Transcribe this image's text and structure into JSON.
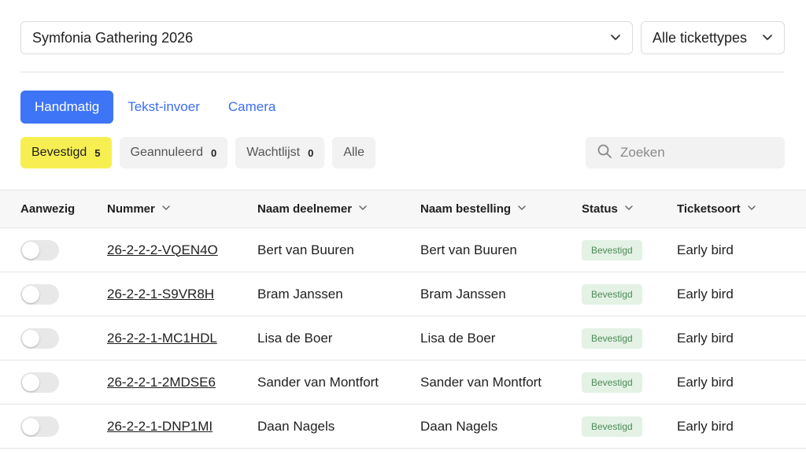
{
  "event_select": {
    "value": "Symfonia Gathering 2026"
  },
  "ticket_select": {
    "value": "Alle tickettypes"
  },
  "tabs": [
    {
      "label": "Handmatig",
      "active": true
    },
    {
      "label": "Tekst-invoer",
      "active": false
    },
    {
      "label": "Camera",
      "active": false
    }
  ],
  "filters": [
    {
      "label": "Bevestigd",
      "count": "5"
    },
    {
      "label": "Geannuleerd",
      "count": "0"
    },
    {
      "label": "Wachtlijst",
      "count": "0"
    },
    {
      "label": "Alle",
      "count": ""
    }
  ],
  "search": {
    "placeholder": "Zoeken"
  },
  "table": {
    "headers": [
      "Aanwezig",
      "Nummer",
      "Naam deelnemer",
      "Naam bestelling",
      "Status",
      "Ticketsoort"
    ],
    "rows": [
      {
        "present": false,
        "number": "26-2-2-2-VQEN4O",
        "participant": "Bert van Buuren",
        "order": "Bert van Buuren",
        "status": "Bevestigd",
        "ticket": "Early bird"
      },
      {
        "present": false,
        "number": "26-2-2-1-S9VR8H",
        "participant": "Bram Janssen",
        "order": "Bram Janssen",
        "status": "Bevestigd",
        "ticket": "Early bird"
      },
      {
        "present": false,
        "number": "26-2-2-1-MC1HDL",
        "participant": "Lisa de Boer",
        "order": "Lisa de Boer",
        "status": "Bevestigd",
        "ticket": "Early bird"
      },
      {
        "present": false,
        "number": "26-2-2-1-2MDSE6",
        "participant": "Sander van Montfort",
        "order": "Sander van Montfort",
        "status": "Bevestigd",
        "ticket": "Early bird"
      },
      {
        "present": false,
        "number": "26-2-2-1-DNP1MI",
        "participant": "Daan Nagels",
        "order": "Daan Nagels",
        "status": "Bevestigd",
        "ticket": "Early bird"
      }
    ]
  },
  "colors": {
    "primary": "#3e74f6",
    "active_filter": "#f7ef52",
    "status_badge_bg": "#e4f2e6",
    "status_badge_text": "#4b8a55"
  }
}
